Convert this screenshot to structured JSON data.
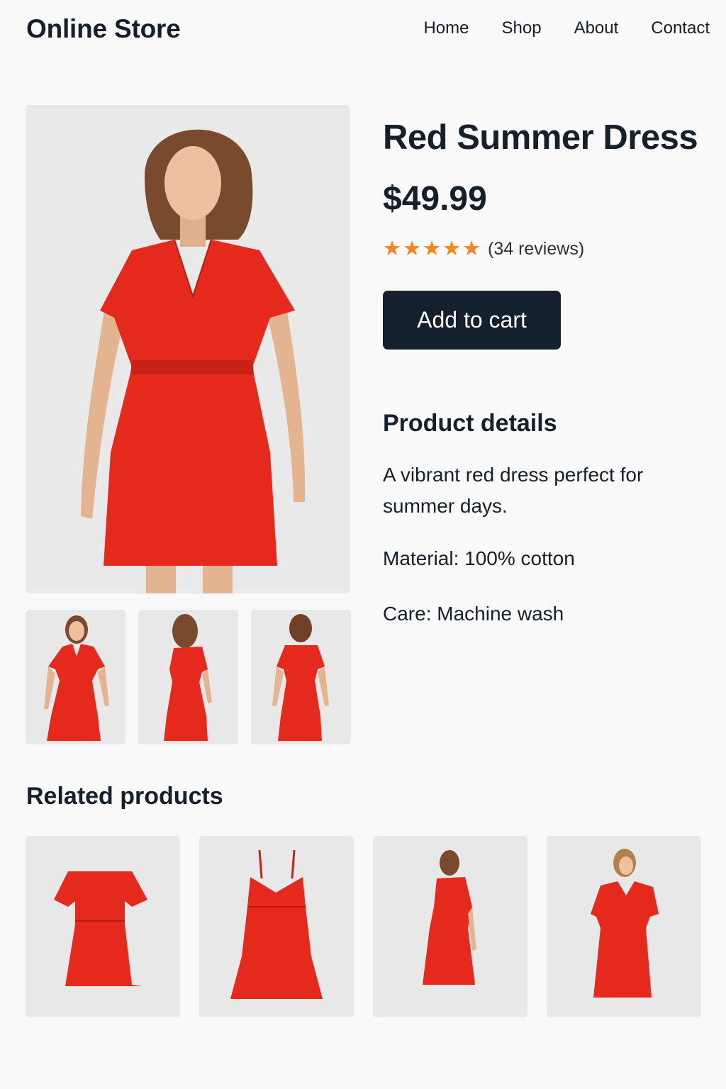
{
  "brand": "Online Store",
  "nav": [
    "Home",
    "Shop",
    "About",
    "Contact"
  ],
  "product": {
    "title": "Red Summer Dress",
    "price": "$49.99",
    "rating": 5,
    "reviews": "(34 reviews)",
    "cta": "Add to cart",
    "details_heading": "Product details",
    "description": "A vibrant red dress perfect for summer days.",
    "material": "Material: 100% cotton",
    "care": "Care: Machine wash"
  },
  "related_heading": "Related products",
  "colors": {
    "accent": "#14202b",
    "dress_red": "#e5291c",
    "star": "#f5861a",
    "background": "#f9f9f9"
  }
}
